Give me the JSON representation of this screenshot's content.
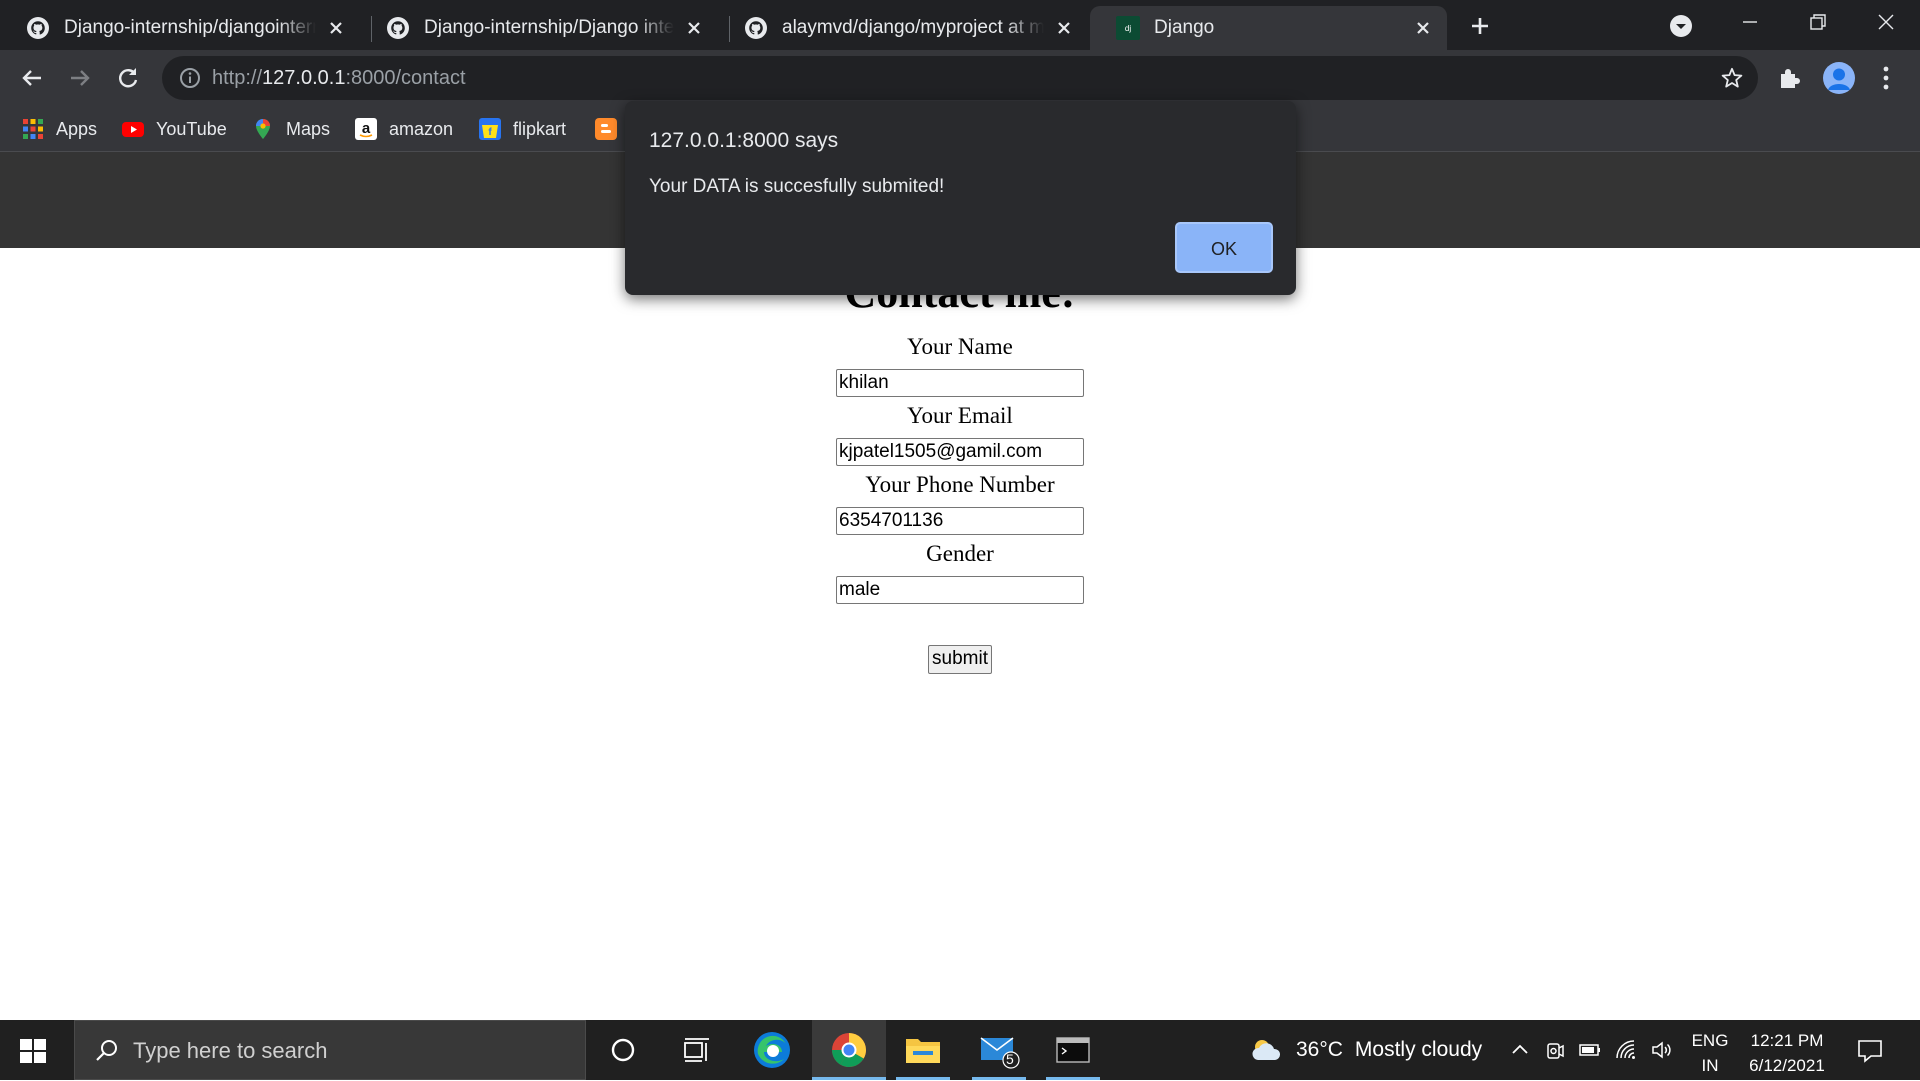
{
  "browser": {
    "tabs": [
      {
        "title": "Django-internship/djangointernship",
        "favicon": "github-icon",
        "active": false
      },
      {
        "title": "Django-internship/Django intership",
        "favicon": "github-icon",
        "active": false
      },
      {
        "title": "alaymvd/django/myproject at master",
        "favicon": "github-icon",
        "active": false
      },
      {
        "title": "Django",
        "favicon": "django-icon",
        "active": true
      }
    ],
    "url_scheme": "http://",
    "url_host": "127.0.0.1",
    "url_path": ":8000/contact",
    "bookmarks": [
      {
        "label": "Apps",
        "icon": "apps-grid-icon"
      },
      {
        "label": "YouTube",
        "icon": "youtube-icon"
      },
      {
        "label": "Maps",
        "icon": "maps-pin-icon"
      },
      {
        "label": "amazon",
        "icon": "amazon-icon"
      },
      {
        "label": "flipkart",
        "icon": "flipkart-icon"
      }
    ]
  },
  "page": {
    "title": "Contact me:",
    "fields": [
      {
        "label": "Your Name",
        "value": "khilan"
      },
      {
        "label": "Your Email",
        "value": "kjpatel1505@gamil.com"
      },
      {
        "label": "Your Phone Number",
        "value": "6354701136"
      },
      {
        "label": "Gender",
        "value": "male"
      }
    ],
    "submit_label": "submit"
  },
  "dialog": {
    "title": "127.0.0.1:8000 says",
    "message": "Your DATA is succesfully submited!",
    "ok_label": "OK"
  },
  "taskbar": {
    "search_placeholder": "Type here to search",
    "mail_badge": "5",
    "weather_temp": "36°C",
    "weather_text": "Mostly cloudy",
    "lang_line1": "ENG",
    "lang_line2": "IN",
    "time": "12:21 PM",
    "date": "6/12/2021"
  },
  "colors": {
    "tabstrip": "#202124",
    "toolbar": "#35363a",
    "dialog_bg": "#292a2d",
    "dialog_button": "#8ab4f8",
    "page_header": "#343434",
    "taskbar": "#202020"
  }
}
